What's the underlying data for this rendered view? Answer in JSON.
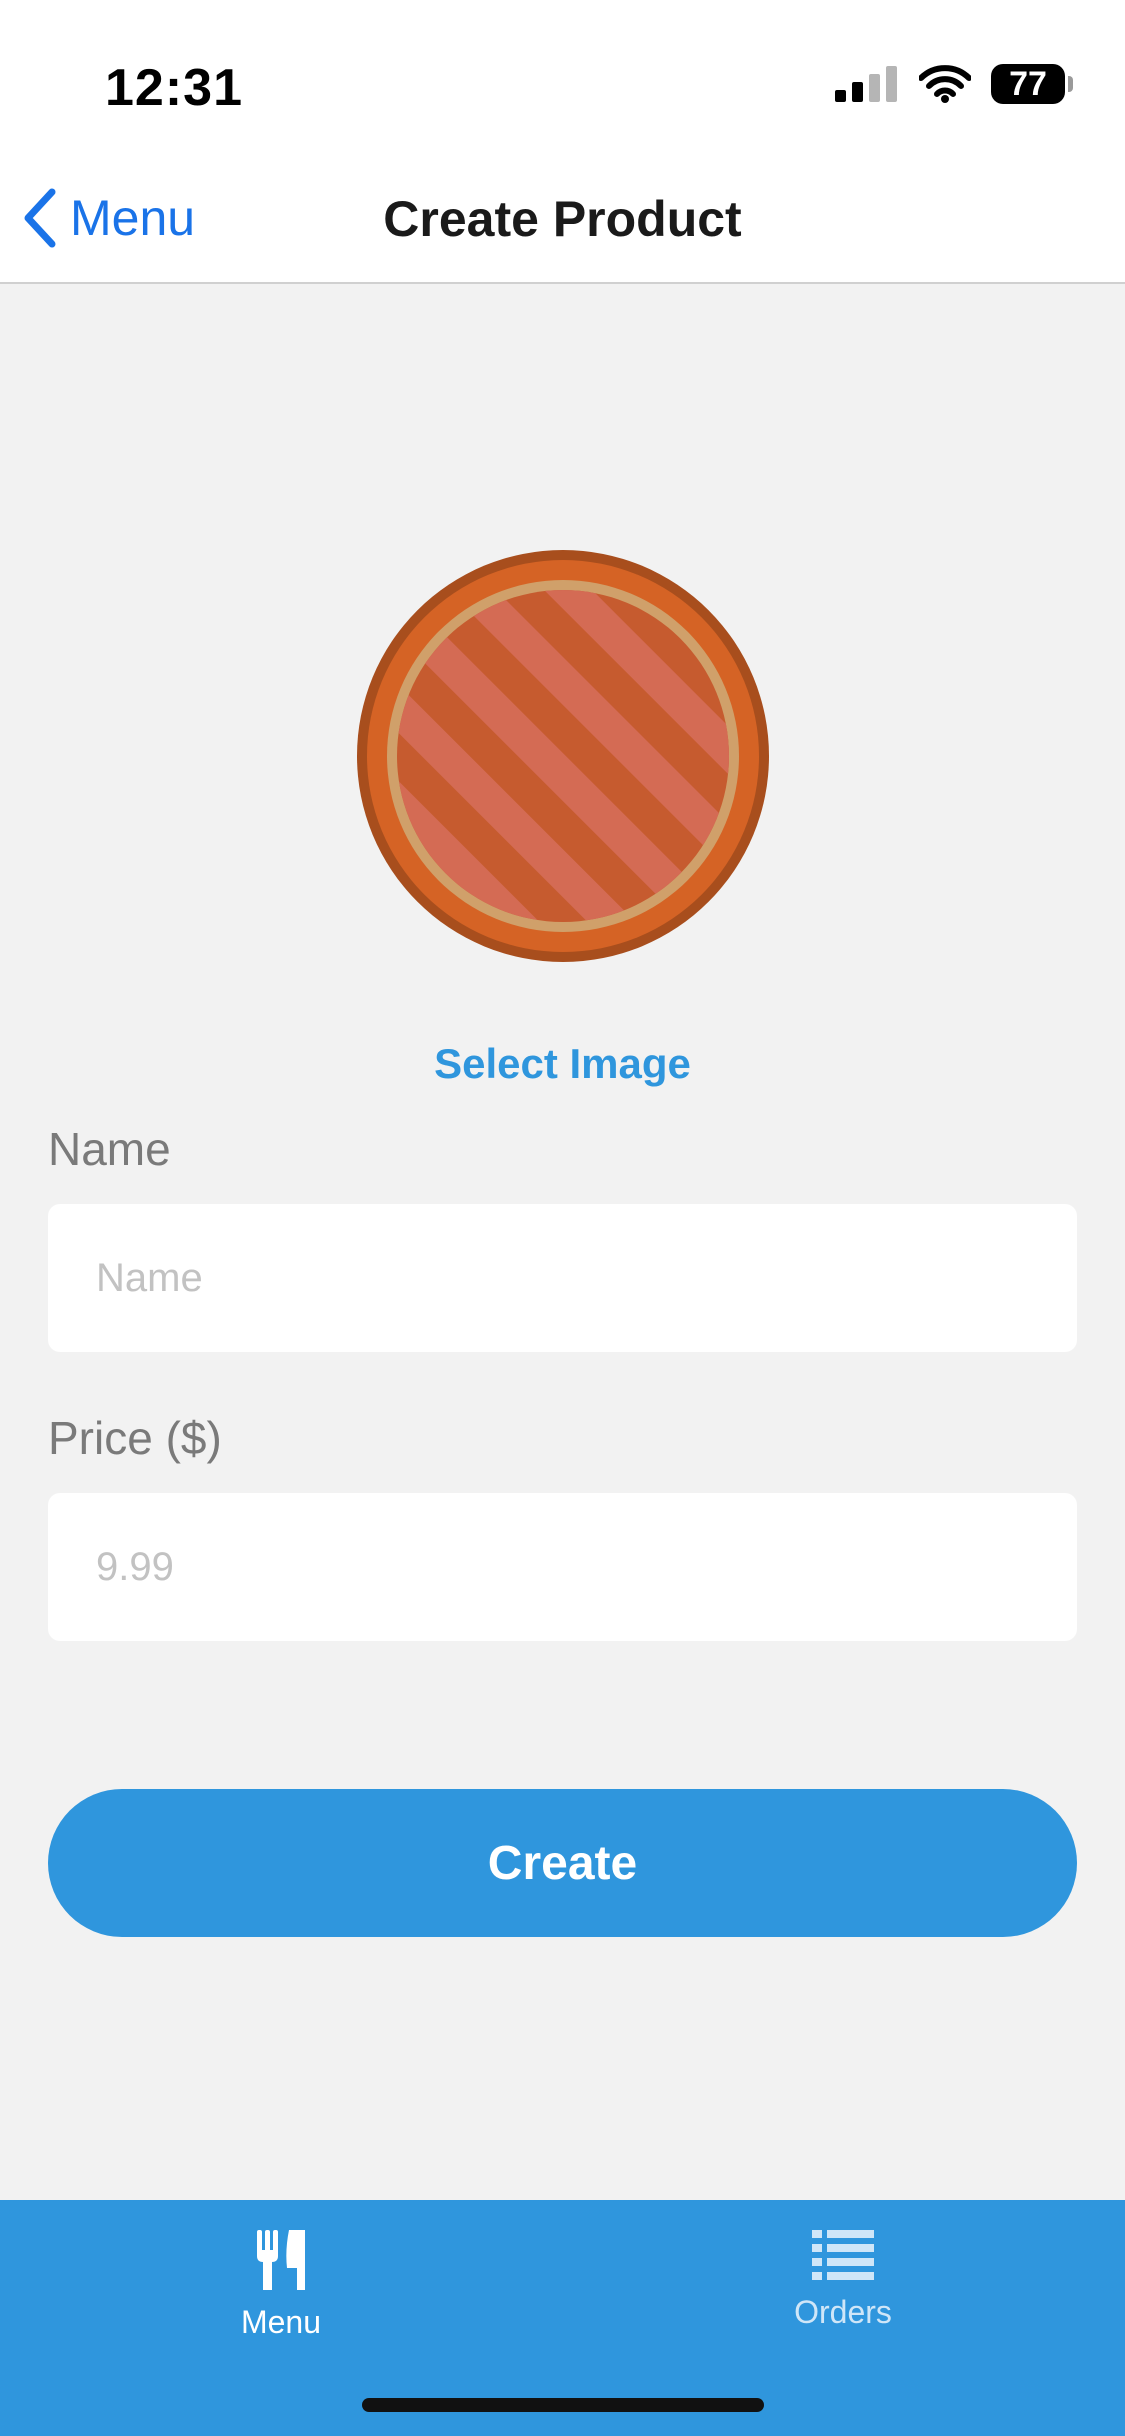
{
  "status_bar": {
    "time": "12:31",
    "battery": "77",
    "icons": [
      "signal-icon",
      "wifi-icon",
      "battery-icon"
    ]
  },
  "nav": {
    "back_label": "Menu",
    "title": "Create Product"
  },
  "image": {
    "select_label": "Select Image",
    "icon": "pizza-placeholder-icon"
  },
  "form": {
    "name_label": "Name",
    "name_value": "",
    "name_placeholder": "Name",
    "price_label": "Price ($)",
    "price_value": "",
    "price_placeholder": "9.99"
  },
  "actions": {
    "create_label": "Create"
  },
  "tabs": [
    {
      "label": "Menu",
      "icon": "fork-knife-icon",
      "active": true
    },
    {
      "label": "Orders",
      "icon": "list-icon",
      "active": false
    }
  ],
  "colors": {
    "accent": "#2f96dd",
    "ios_blue": "#1a73e8",
    "background": "#f2f2f2",
    "tab_active": "#ffffff",
    "tab_inactive": "#cfe6f8"
  }
}
